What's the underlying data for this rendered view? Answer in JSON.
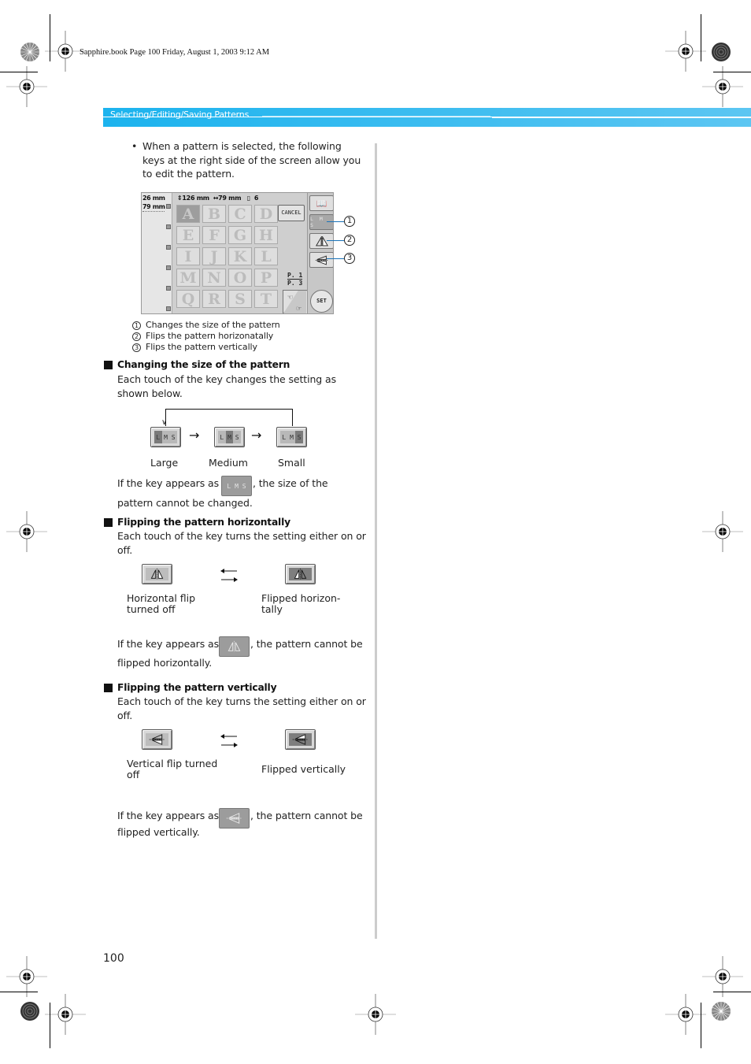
{
  "slug": "Sapphire.book  Page 100  Friday, August 1, 2003  9:12 AM",
  "header": {
    "section_title": "Selecting/Editing/Saving Patterns",
    "accent_color": "#1cb3ee"
  },
  "intro": {
    "bullet_lines": [
      "When a pattern is selected, the following",
      "keys at the right side of the screen allow you",
      "to edit the pattern."
    ]
  },
  "screen": {
    "dim_width": "26 mm",
    "dim_height": "79 mm",
    "info_height": "126 mm",
    "info_width": "79 mm",
    "info_color_count": "6",
    "letters": [
      "A",
      "B",
      "C",
      "D",
      "E",
      "F",
      "G",
      "H",
      "I",
      "J",
      "K",
      "L",
      "M",
      "N",
      "O",
      "P",
      "Q",
      "R",
      "S",
      "T"
    ],
    "selected_letter": "A",
    "cancel_label": "CANCEL",
    "page_current": "P. 1",
    "page_total": "P. 3",
    "set_label": "SET",
    "lms_label": "L M S",
    "callouts": [
      "1",
      "2",
      "3"
    ]
  },
  "legend": [
    {
      "num": "1",
      "text": "Changes the size of the pattern"
    },
    {
      "num": "2",
      "text": "Flips the pattern horizonatally"
    },
    {
      "num": "3",
      "text": "Flips the pattern vertically"
    }
  ],
  "size_section": {
    "heading": "Changing the size of the pattern",
    "lines": [
      "Each touch of the key changes the setting as",
      "shown below."
    ],
    "states": [
      {
        "label": "Large",
        "active": "L"
      },
      {
        "label": "Medium",
        "active": "M"
      },
      {
        "label": "Small",
        "active": "S"
      }
    ],
    "key_letters": [
      "L",
      "M",
      "S"
    ],
    "arrow": "→",
    "disabled_line1_before": "If the key appears as",
    "disabled_line1_after": ", the size of the",
    "disabled_line2": "pattern cannot be changed."
  },
  "hflip_section": {
    "heading": "Flipping the pattern horizontally",
    "lines": [
      "Each touch of the key turns the setting either on or",
      "off."
    ],
    "off_label_lines": [
      "Horizontal flip",
      "turned off"
    ],
    "on_label_lines": [
      "Flipped horizon-",
      "tally"
    ],
    "disabled_line1_before": "If the key appears as",
    "disabled_line1_after": ", the pattern cannot be",
    "disabled_line2": "flipped horizontally."
  },
  "vflip_section": {
    "heading": "Flipping the pattern vertically",
    "lines": [
      "Each touch of the key turns the setting either on or",
      "off."
    ],
    "off_label_lines": [
      "Vertical flip turned",
      "off"
    ],
    "on_label": "Flipped vertically",
    "disabled_line1_before": "If the key appears as",
    "disabled_line1_after": ", the pattern cannot be",
    "disabled_line2": "flipped vertically."
  },
  "page_number": "100"
}
